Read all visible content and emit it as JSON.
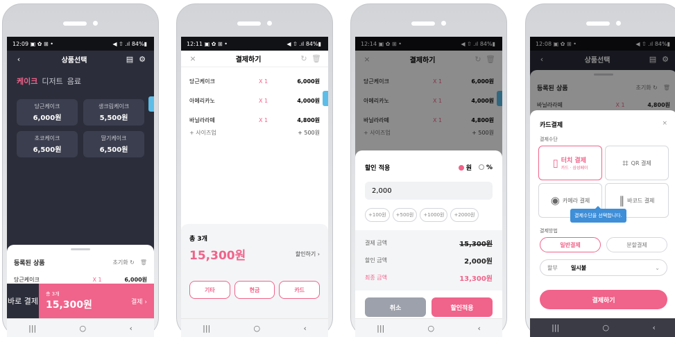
{
  "colors": {
    "accent": "#f0638a",
    "dark": "#2b2d3a",
    "info": "#3e8ed8"
  },
  "screen1": {
    "status_time": "12:09",
    "status_icons": "▣ ✿ ⊞ •",
    "status_right": "◀ ⇧ .ıl 84%▮",
    "title": "상품선택",
    "back_icon": "‹",
    "receipt_icon": "▤",
    "gear_icon": "⚙",
    "tabs": [
      "케이크",
      "디저트",
      "음료"
    ],
    "products": [
      {
        "name": "당근케이크",
        "price": "6,000원"
      },
      {
        "name": "생크림케이크",
        "price": "5,500원"
      },
      {
        "name": "초코케이크",
        "price": "6,500원"
      },
      {
        "name": "딸기케이크",
        "price": "6,500원"
      }
    ],
    "sheet_title": "등록된 상품",
    "reset_label": "초기화",
    "refresh_icon": "↻",
    "trash_icon": "🗑",
    "item": {
      "name": "당근케이크",
      "qty": "X 1",
      "price": "6,000원"
    },
    "direct_label": "바로 결제",
    "total_count": "총 3개",
    "total_price": "15,300원",
    "pay_label": "결제 ›"
  },
  "screen2": {
    "status_time": "12:11",
    "title": "결제하기",
    "close_icon": "×",
    "items": [
      {
        "name": "당근케이크",
        "qty": "X 1",
        "price": "6,000원"
      },
      {
        "name": "아메리카노",
        "qty": "X 1",
        "price": "4,000원"
      },
      {
        "name": "바닐라라떼",
        "qty": "X 1",
        "price": "4,800원"
      }
    ],
    "option": {
      "name": "+ 사이즈업",
      "price": "+ 500원"
    },
    "total_count": "총 3개",
    "total_price": "15,300원",
    "discount_label": "할인하기 ›",
    "buttons": [
      "기타",
      "현금",
      "카드"
    ]
  },
  "screen3": {
    "status_time": "12:14",
    "title": "결제하기",
    "items": [
      {
        "name": "당근케이크",
        "qty": "X 1",
        "price": "6,000원"
      },
      {
        "name": "아메리카노",
        "qty": "X 1",
        "price": "4,000원"
      },
      {
        "name": "바닐라라떼",
        "qty": "X 1",
        "price": "4,800원"
      }
    ],
    "option": {
      "name": "+ 사이즈업",
      "price": "+ 500원"
    },
    "discount_title": "할인 적용",
    "unit_won": "원",
    "unit_pct": "%",
    "discount_value": "2,000",
    "chips": [
      "+100원",
      "+500원",
      "+1000원",
      "+2000원"
    ],
    "pay_amount_label": "결제 금액",
    "pay_amount": "15,300원",
    "discount_amount_label": "할인 금액",
    "discount_amount": "2,000원",
    "final_label": "최종 금액",
    "final_amount": "13,300원",
    "cancel_label": "취소",
    "apply_label": "할인적용"
  },
  "screen4": {
    "status_time": "12:08",
    "title": "상품선택",
    "sheet_title": "등록된 상품",
    "reset_label": "초기화",
    "item": {
      "name": "바닐라라떼",
      "qty": "X 1",
      "price": "4,800원"
    },
    "card_title": "카드결제",
    "method_section": "결제수단",
    "options": [
      {
        "label": "터치 결제",
        "sub": "카드 · 삼성페이",
        "icon": "▯"
      },
      {
        "label": "QR 결제",
        "sub": "",
        "icon": "⌗"
      },
      {
        "label": "카메라 결제",
        "sub": "",
        "icon": "◉"
      },
      {
        "label": "바코드 결제",
        "sub": "",
        "icon": "‖"
      }
    ],
    "tooltip": "결제수단을 선택합니다.",
    "pay_method_section": "결제방법",
    "methods": [
      "일반결제",
      "분할결제"
    ],
    "installment_label": "할부",
    "installment_value": "일시불",
    "pay_button": "결제하기"
  },
  "nav": {
    "recent": "|||",
    "home": "○",
    "back": "‹"
  }
}
